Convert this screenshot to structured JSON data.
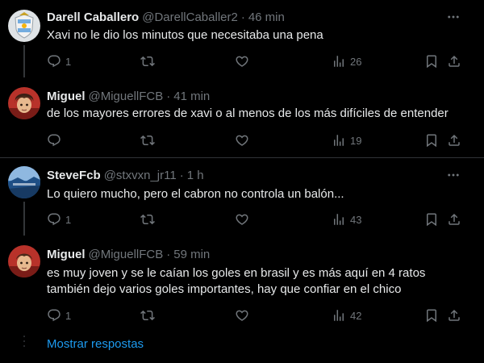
{
  "colors": {
    "background": "#000000",
    "text_primary": "#e7e9ea",
    "text_secondary": "#71767b",
    "accent": "#1d9bf0",
    "divider": "#2f3336"
  },
  "tweets": [
    {
      "name": "Darell Caballero",
      "handle": "@DarellCaballer2",
      "separator": "·",
      "time": "46 min",
      "text": "Xavi no le dio los minutos que necesitaba una pena",
      "avatar_icon": "argentina-crest-avatar",
      "actions": {
        "reply": "1",
        "retweet": "",
        "like": "",
        "views": "26"
      }
    },
    {
      "name": "Miguel",
      "handle": "@MiguellFCB",
      "separator": "·",
      "time": "41 min",
      "text": "de los mayores errores de xavi o al menos de los más difíciles de entender",
      "avatar_icon": "anime-character-avatar",
      "actions": {
        "reply": "",
        "retweet": "",
        "like": "",
        "views": "19"
      }
    },
    {
      "name": "SteveFcb",
      "handle": "@stxvxn_jr11",
      "separator": "·",
      "time": "1 h",
      "text": "Lo quiero mucho, pero el cabron no controla un balón...",
      "avatar_icon": "blue-landscape-avatar",
      "actions": {
        "reply": "1",
        "retweet": "",
        "like": "",
        "views": "43"
      }
    },
    {
      "name": "Miguel",
      "handle": "@MiguellFCB",
      "separator": "·",
      "time": "59 min",
      "text_line1": "es muy joven y se le caían los goles en brasil y es más aquí en 4 ratos",
      "text_line2": "también dejo varios goles importantes, hay que confiar en el chico",
      "avatar_icon": "anime-character-avatar",
      "actions": {
        "reply": "1",
        "retweet": "",
        "like": "",
        "views": "42"
      }
    }
  ],
  "show_replies_label": "Mostrar respostas"
}
